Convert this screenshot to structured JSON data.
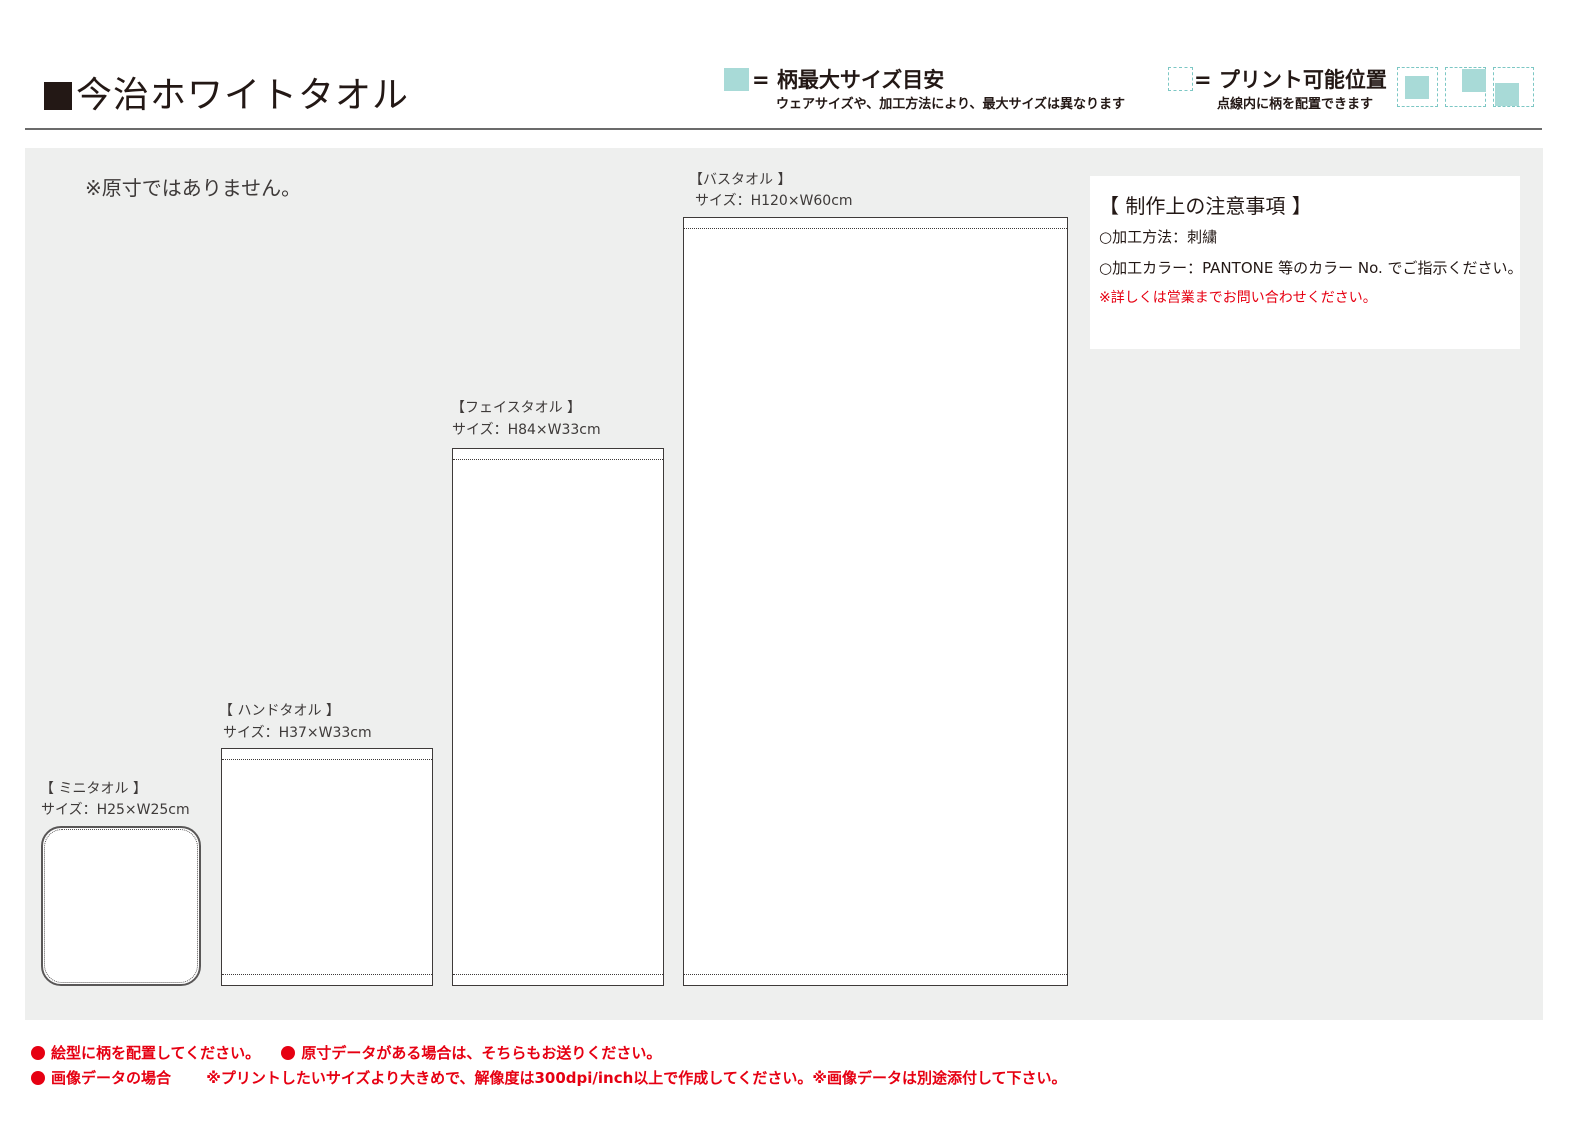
{
  "header": {
    "title": "今治ホワイトタオル",
    "legend_max": {
      "label": "= 柄最大サイズ目安",
      "sub": "ウェアサイズや、加工方法により、最大サイズは異なります",
      "swatch_color": "#a8dad7"
    },
    "legend_print": {
      "label": "= プリント可能位置",
      "sub": "点線内に柄を配置できます",
      "border_color": "#7cc7c4"
    }
  },
  "panel": {
    "not_to_scale": "※原寸ではありません。",
    "towels": [
      {
        "name": "【 ミニタオル 】",
        "size": "サイズ：H25×W25cm"
      },
      {
        "name": "【 ハンドタオル 】",
        "size": "サイズ：H37×W33cm"
      },
      {
        "name": "【フェイスタオル 】",
        "size": "サイズ：H84×W33cm"
      },
      {
        "name": "【バスタオル 】",
        "size": "サイズ：H120×W60cm"
      }
    ],
    "notes": {
      "title": "【 制作上の注意事項 】",
      "method": "○加工方法：刺繍",
      "color": "○加工カラー：PANTONE 等のカラー No. でご指示ください。",
      "contact": "※詳しくは営業までお問い合わせください。"
    }
  },
  "footer": {
    "line1_a": "絵型に柄を配置してください。",
    "line1_b": "原寸データがある場合は、そちらもお送りください。",
    "line2_a": "画像データの場合",
    "line2_b": "※プリントしたいサイズより大きめで、解像度は300dpi/inch以上で作成してください。※画像データは別途添付して下さい。",
    "accent_color": "#e60012"
  }
}
